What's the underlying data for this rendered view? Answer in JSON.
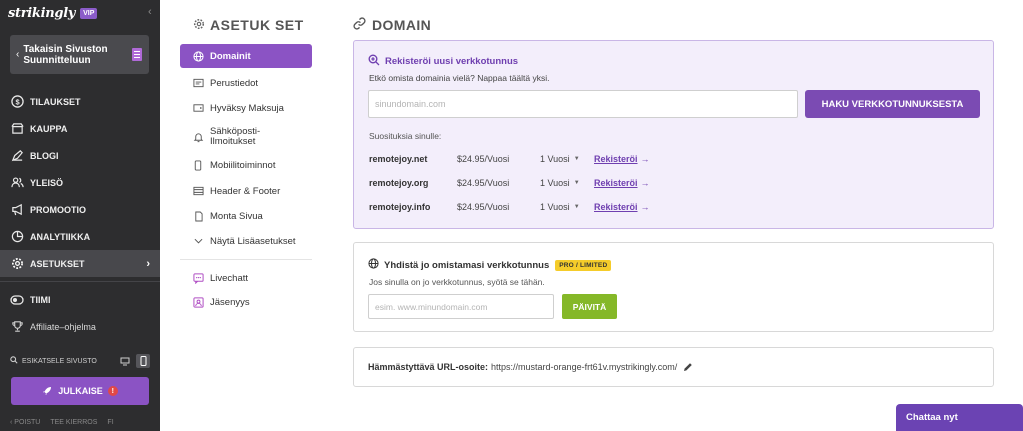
{
  "sidebar": {
    "logo": "strikingly",
    "vip": "VIP",
    "back_label": "Takaisin Sivuston Suunnitteluun",
    "nav": [
      {
        "label": "TILAUKSET",
        "icon": "dollar-icon"
      },
      {
        "label": "KAUPPA",
        "icon": "store-icon"
      },
      {
        "label": "BLOGI",
        "icon": "pen-icon"
      },
      {
        "label": "YLEISÖ",
        "icon": "users-icon"
      },
      {
        "label": "PROMOOTIO",
        "icon": "megaphone-icon"
      },
      {
        "label": "ANALYTIIKKA",
        "icon": "pie-chart-icon"
      },
      {
        "label": "ASETUKSET",
        "icon": "gear-icon"
      },
      {
        "label": "TIIMI",
        "icon": "toggle-icon"
      },
      {
        "label": "Affiliate–ohjelma",
        "icon": "trophy-icon"
      }
    ],
    "preview_label": "ESIKATSELE SIVUSTO",
    "publish_label": "JULKAISE",
    "publish_warning": "!",
    "footer": [
      "POISTU",
      "TEE KIERROS",
      "FI"
    ]
  },
  "settings_menu": {
    "title": "ASETUK SET",
    "items": [
      {
        "label": "Domainit",
        "icon": "globe-icon",
        "active": true
      },
      {
        "label": "Perustiedot",
        "icon": "id-card-icon"
      },
      {
        "label": "Hyväksy Maksuja",
        "icon": "wallet-icon"
      },
      {
        "label": "Sähköposti-Ilmoitukset",
        "icon": "bell-icon"
      },
      {
        "label": "Mobiilitoiminnot",
        "icon": "mobile-icon"
      },
      {
        "label": "Header & Footer",
        "icon": "layout-icon"
      },
      {
        "label": "Monta Sivua",
        "icon": "pages-icon"
      },
      {
        "label": "Näytä Lisäasetukset",
        "icon": "chevron-down-icon"
      },
      {
        "label": "Livechatt",
        "icon": "chat-icon"
      },
      {
        "label": "Jäsenyys",
        "icon": "member-icon"
      }
    ]
  },
  "domain": {
    "title": "DOMAIN",
    "register": {
      "heading": "Rekisteröi uusi verkkotunnus",
      "subtext": "Etkö omista domainia vielä? Nappaa täältä yksi.",
      "input_placeholder": "sinundomain.com",
      "search_button": "HAKU VERKKOTUNNUKSESTA",
      "suggestions_label": "Suosituksia sinulle:",
      "suggestions": [
        {
          "domain": "remotejoy.net",
          "price": "$24.95/Vuosi",
          "duration": "1 Vuosi",
          "action": "Rekisteröi",
          "arrow": "→"
        },
        {
          "domain": "remotejoy.org",
          "price": "$24.95/Vuosi",
          "duration": "1 Vuosi",
          "action": "Rekisteröi",
          "arrow": "→"
        },
        {
          "domain": "remotejoy.info",
          "price": "$24.95/Vuosi",
          "duration": "1 Vuosi",
          "action": "Rekisteröi",
          "arrow": "→"
        }
      ]
    },
    "connect": {
      "heading": "Yhdistä jo omistamasi verkkotunnus",
      "badge": "PRO / LIMITED",
      "subtext": "Jos sinulla on jo verkkotunnus, syötä se tähän.",
      "input_placeholder": "esim. www.minundomain.com",
      "update_button": "PÄIVITÄ"
    },
    "url": {
      "label": "Hämmästyttävä URL-osoite:",
      "value": "https://mustard-orange-frt61v.mystrikingly.com/"
    }
  },
  "chat_button": "Chattaa nyt",
  "colors": {
    "accent": "#8b53c4",
    "sidebar_bg": "#2d2d2f",
    "update_green": "#85b828",
    "badge_yellow": "#f5cc2a"
  }
}
